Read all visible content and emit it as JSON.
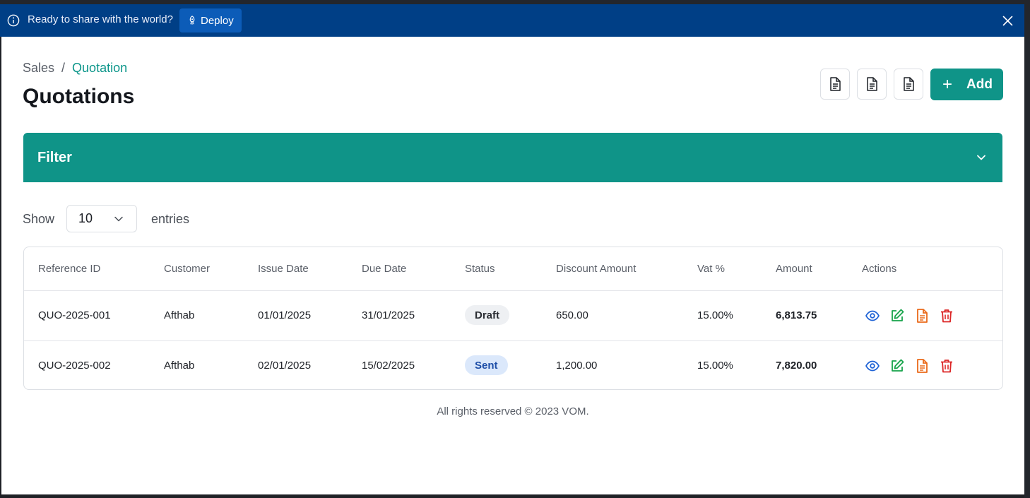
{
  "banner": {
    "message": "Ready to share with the world?",
    "deploy_label": "Deploy",
    "bg_color": "#003f86"
  },
  "breadcrumb": {
    "parent": "Sales",
    "separator": "/",
    "current": "Quotation"
  },
  "page_title": "Quotations",
  "toolbar": {
    "add_label": "Add",
    "icons": [
      "document-icon",
      "document-icon",
      "document-icon"
    ]
  },
  "filter": {
    "label": "Filter"
  },
  "entries": {
    "show_label": "Show",
    "value": "10",
    "suffix": "entries"
  },
  "table": {
    "headers": [
      "Reference ID",
      "Customer",
      "Issue Date",
      "Due Date",
      "Status",
      "Discount Amount",
      "Vat %",
      "Amount",
      "Actions"
    ],
    "rows": [
      {
        "ref": "QUO-2025-001",
        "customer": "Afthab",
        "issue": "01/01/2025",
        "due": "31/01/2025",
        "status": "Draft",
        "discount": "650.00",
        "vat": "15.00%",
        "amount": "6,813.75"
      },
      {
        "ref": "QUO-2025-002",
        "customer": "Afthab",
        "issue": "02/01/2025",
        "due": "15/02/2025",
        "status": "Sent",
        "discount": "1,200.00",
        "vat": "15.00%",
        "amount": "7,820.00"
      }
    ]
  },
  "footer": "All rights reserved © 2023 VOM.",
  "colors": {
    "accent": "#0f9488",
    "view": "#1f63d6",
    "edit": "#16a34a",
    "pdf": "#ea6a1a",
    "delete": "#dc2626"
  }
}
